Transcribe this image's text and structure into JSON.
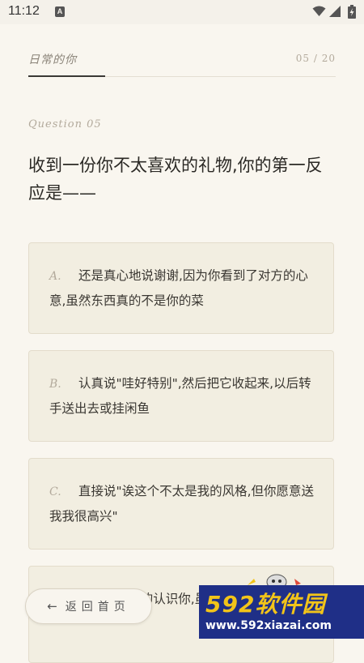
{
  "status_bar": {
    "time": "11:12",
    "notification_icon": "A"
  },
  "header": {
    "title": "日常的你",
    "progress_text": "05 / 20",
    "progress_fraction": 0.25
  },
  "question": {
    "number_label": "Question 05",
    "text": "收到一份你不太喜欢的礼物,你的第一反应是——"
  },
  "options": [
    {
      "letter": "A.",
      "text": "还是真心地说谢谢,因为你看到了对方的心意,虽然东西真的不是你的菜"
    },
    {
      "letter": "B.",
      "text": "认真说\"哇好特别\",然后把它收起来,以后转手送出去或挂闲鱼"
    },
    {
      "letter": "C.",
      "text": "直接说\"诶这个不太是我的风格,但你愿意送我我很高兴\""
    },
    {
      "letter": "D.",
      "text": "始想这个...的认识你,虽然你不会说"
    }
  ],
  "home_button": {
    "arrow": "←",
    "label": "返回首页"
  },
  "watermark": {
    "brand": "592软件园",
    "url": "www.592xiazai.com"
  },
  "colors": {
    "background": "#f9f6ef",
    "card": "#f2eee1",
    "accent_text": "#b3aa9c",
    "watermark_bg": "#1f2f87",
    "watermark_yellow": "#f2c419"
  }
}
